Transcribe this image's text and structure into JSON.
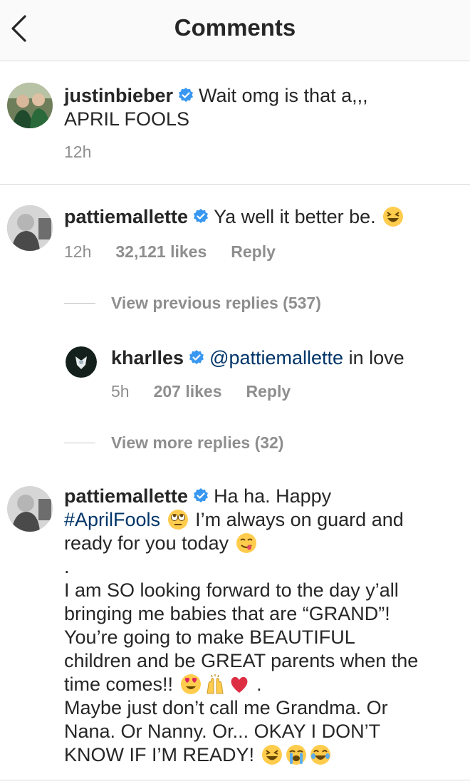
{
  "header": {
    "title": "Comments"
  },
  "comments": [
    {
      "username": "justinbieber",
      "text_line1": "Wait omg is that a,,,",
      "text_line2": "APRIL FOOLS",
      "time": "12h"
    },
    {
      "username": "pattiemallette",
      "text": "Ya well it better be.",
      "time": "12h",
      "likes": "32,121 likes",
      "reply": "Reply",
      "view_previous": "View previous replies (537)",
      "replies": [
        {
          "username": "kharlles",
          "mention": "@pattiemallette",
          "text": " in love",
          "time": "5h",
          "likes": "207 likes",
          "reply": "Reply"
        }
      ],
      "view_more": "View more replies (32)"
    },
    {
      "username": "pattiemallette",
      "line1": "Ha ha. Happy",
      "hashtag": "#AprilFools",
      "line2_rest": " I’m always on guard and",
      "line3": "ready for you today",
      "dot": ".",
      "line5": "I am SO looking forward to the day y’all",
      "line6": "bringing me babies that are “GRAND”!",
      "line7": "You’re going to make BEAUTIFUL",
      "line8": "children and be GREAT parents when the",
      "line9": "time comes!!",
      "line9_end": " .",
      "line10": "Maybe just don’t call me Grandma. Or",
      "line11": "Nana. Or Nanny. Or... OKAY I DON’T",
      "line12": "KNOW IF I’M READY!"
    }
  ],
  "colors": {
    "verified": "#3897f0",
    "link": "#003569",
    "meta": "#8e8e8e"
  },
  "icons": [
    "chevron-left-icon",
    "verified-badge-icon",
    "laughing-emoji",
    "rolling-eyes-emoji",
    "yum-emoji",
    "heart-eyes-emoji",
    "raised-hands-emoji",
    "red-heart-emoji",
    "crying-emoji",
    "tears-of-joy-emoji"
  ]
}
